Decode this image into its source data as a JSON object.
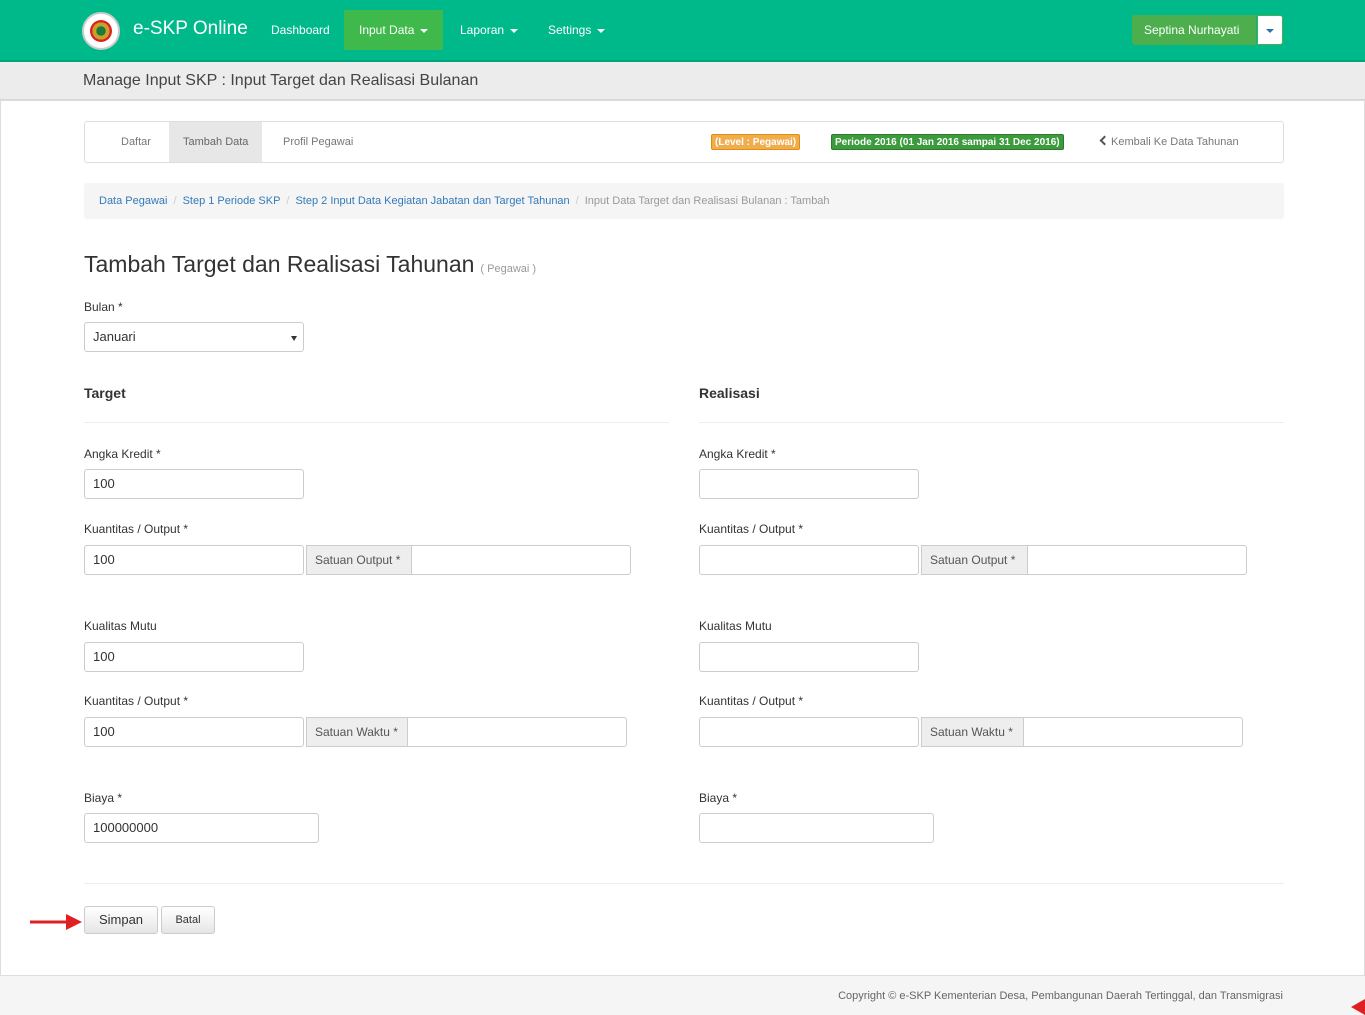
{
  "app": {
    "brand": "e-SKP Online",
    "nav": [
      "Dashboard",
      "Input Data",
      "Laporan",
      "Settings"
    ],
    "user_name": "Septina Nurhayati"
  },
  "page": {
    "header_title": "Manage Input SKP : Input Target dan Realisasi Bulanan"
  },
  "tabs": {
    "daftar": "Daftar",
    "tambah": "Tambah Data",
    "profil": "Profil Pegawai",
    "level_badge": "(Level : Pegawai)",
    "periode_badge": "Periode 2016 (01 Jan 2016 sampai 31 Dec 2016)",
    "back_link": "Kembali Ke Data Tahunan"
  },
  "breadcrumb": {
    "item1": "Data Pegawai",
    "item2": "Step 1 Periode SKP",
    "item3": "Step 2 Input Data Kegiatan Jabatan dan Target Tahunan",
    "current": "Input Data Target dan Realisasi Bulanan : Tambah",
    "separator": "/"
  },
  "form": {
    "title": "Tambah Target dan Realisasi Tahunan",
    "title_small": "( Pegawai )",
    "bulan_label": "Bulan *",
    "bulan_value": "Januari",
    "target_title": "Target",
    "realisasi_title": "Realisasi",
    "labels": {
      "angka_kredit": "Angka Kredit *",
      "kuantitas": "Kuantitas / Output *",
      "satuan_output": "Satuan Output *",
      "kualitas": "Kualitas Mutu",
      "satuan_waktu": "Satuan Waktu *",
      "biaya": "Biaya *"
    },
    "target": {
      "angka_kredit": "100",
      "kuantitas": "100",
      "satuan_output": "",
      "kualitas": "100",
      "kuantitas_waktu": "100",
      "satuan_waktu": "",
      "biaya": "100000000"
    },
    "realisasi": {
      "angka_kredit": "",
      "kuantitas": "",
      "satuan_output": "",
      "kualitas": "",
      "kuantitas_waktu": "",
      "satuan_waktu": "",
      "biaya": ""
    },
    "save_label": "Simpan",
    "cancel_label": "Batal"
  },
  "footer": {
    "copyright": "Copyright © e-SKP Kementerian Desa, Pembangunan Daerah Tertinggal, dan Transmigrasi"
  },
  "colors": {
    "navbar": "#00b98b",
    "active_nav": "#3fb84c",
    "link": "#337ab7",
    "badge_level": "#f0ad4e",
    "badge_periode": "#3c9b3c",
    "arrow": "#e02020"
  }
}
